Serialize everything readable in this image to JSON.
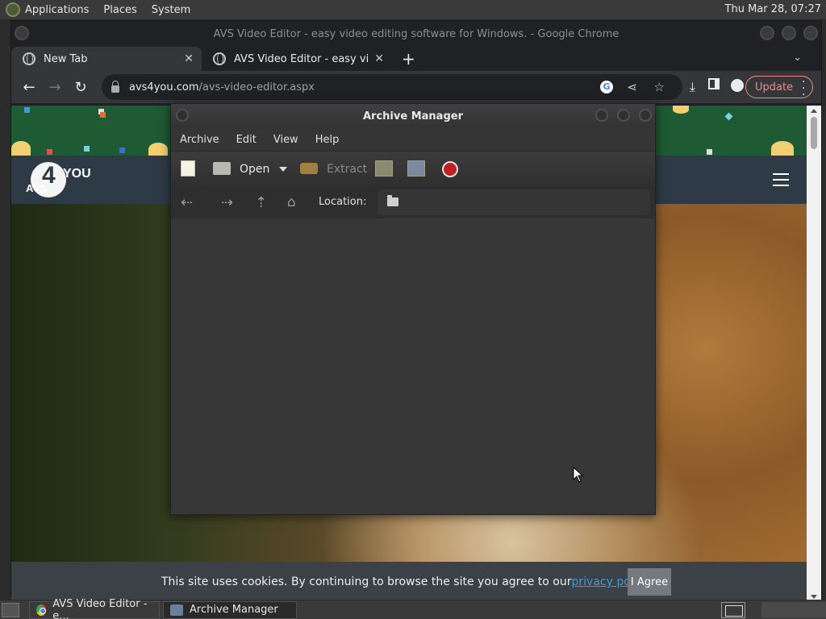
{
  "top_panel": {
    "menus": [
      "Applications",
      "Places",
      "System"
    ],
    "clock": "Thu Mar 28, 07:27"
  },
  "chrome": {
    "window_title": "AVS Video Editor - easy video editing software for Windows. - Google Chrome",
    "tabs": [
      {
        "label": "New Tab"
      },
      {
        "label": "AVS Video Editor - easy video"
      }
    ],
    "url_host": "avs4you.com",
    "url_path": "/avs-video-editor.aspx",
    "update_label": "Update"
  },
  "site": {
    "logo_four": "4",
    "logo_you": "YOU",
    "logo_avs": "AVS",
    "cookie_text": "This site uses cookies. By continuing to browse the site you agree to our ",
    "cookie_link": "privacy policy",
    "cookie_period": ".",
    "agree_label": "I Agree"
  },
  "archive_manager": {
    "title": "Archive Manager",
    "menus": [
      "Archive",
      "Edit",
      "View",
      "Help"
    ],
    "toolbar": {
      "open_label": "Open",
      "extract_label": "Extract"
    },
    "location_label": "Location:"
  },
  "taskbar": {
    "tasks": [
      "AVS Video Editor - e...",
      "Archive Manager"
    ]
  }
}
